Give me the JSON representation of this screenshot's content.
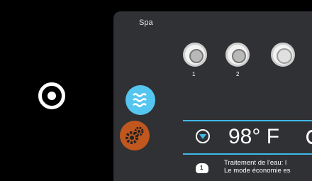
{
  "screen": {
    "title": "Spa"
  },
  "pumps": [
    {
      "label": "1"
    },
    {
      "label": "2"
    },
    {
      "label": ""
    }
  ],
  "temperature": {
    "value": "98° F"
  },
  "message": {
    "line1": "Traitement de l'eau: l",
    "line2": "Le mode économie es",
    "icon_label": "1"
  },
  "icons": {
    "home": "target-circle-icon",
    "jets": "water-waves-icon",
    "settings": "gears-icon",
    "down": "down-arrow-icon",
    "message": "pump-status-icon"
  },
  "colors": {
    "accent": "#3fb8ea",
    "jets": "#55c6ef",
    "settings": "#c0571f",
    "panel": "#2f3134"
  }
}
